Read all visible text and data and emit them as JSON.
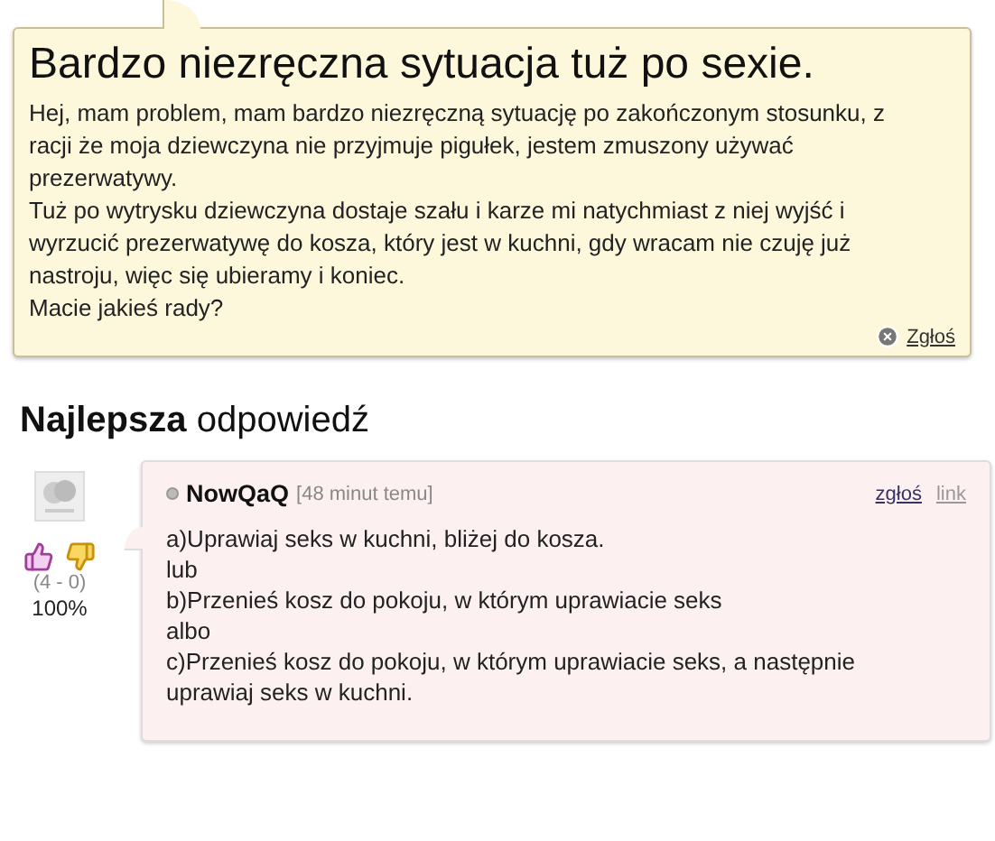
{
  "question": {
    "title": "Bardzo niezręczna sytuacja tuż po sexie.",
    "paragraphs": [
      "Hej, mam problem, mam bardzo niezręczną sytuację po zakończonym stosunku, z racji że moja dziewczyna nie przyjmuje pigułek, jestem zmuszony używać prezerwatywy.",
      "Tuż po wytrysku dziewczyna dostaje szału i karze mi natychmiast z niej wyjść i wyrzucić prezerwatywę do kosza, który jest w kuchni, gdy wracam nie czuję już nastroju, więc się ubieramy i koniec.",
      "Macie jakieś rady?"
    ],
    "report": "Zgłoś"
  },
  "heading": "**Najlepsza** odpowiedź",
  "answer": {
    "author": "NowQaQ",
    "time": "[48 minut temu]",
    "actions": [
      "zgłoś",
      "link"
    ],
    "votes": "(4 - 0)",
    "percent": "100%",
    "lines": [
      "a)Uprawiaj seks w kuchni, bliżej do kosza.",
      "lub",
      "b)Przenieś kosz do pokoju, w którym uprawiacie seks",
      "albo",
      "c)Przenieś kosz do pokoju, w którym uprawiacie seks, a następnie uprawiaj seks w kuchni."
    ]
  }
}
